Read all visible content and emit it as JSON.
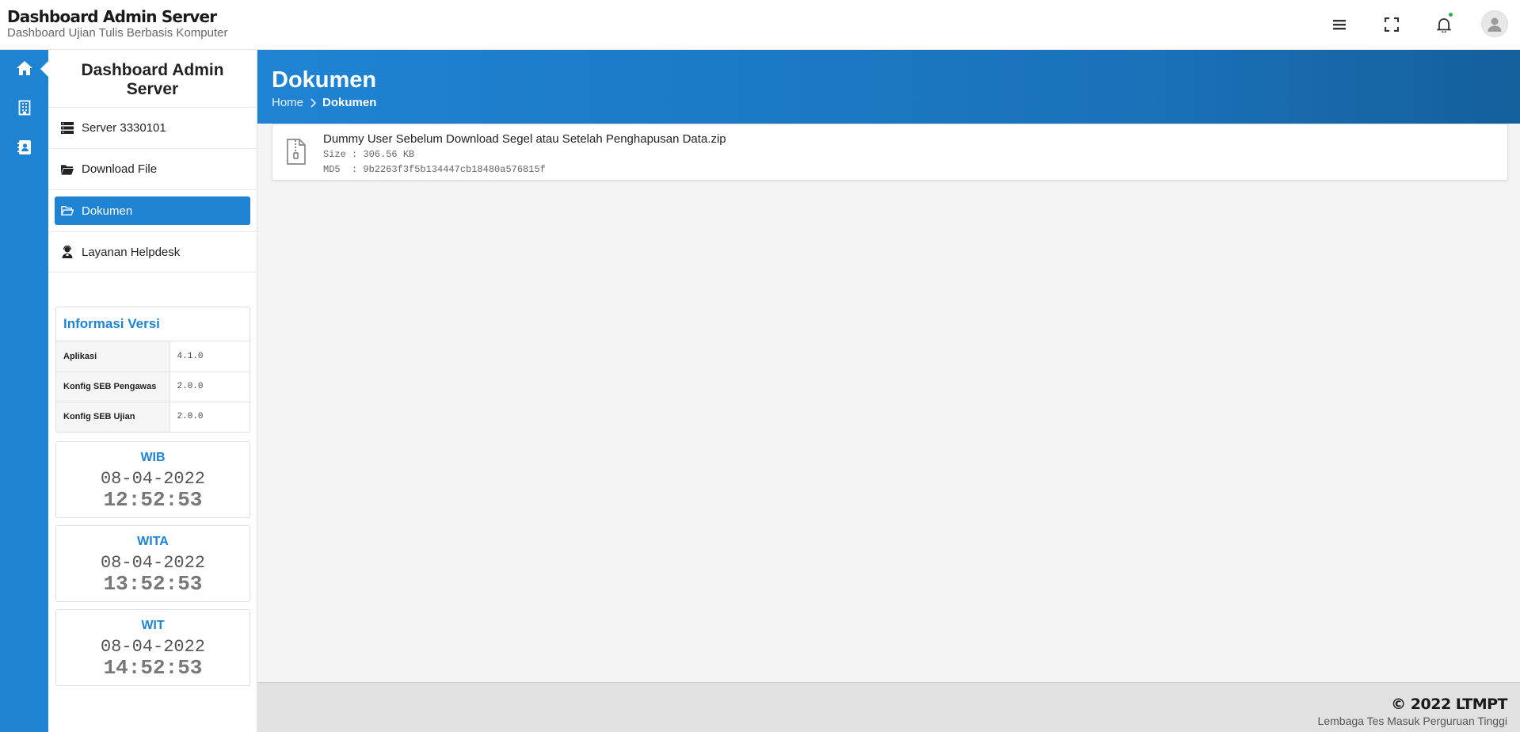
{
  "header": {
    "title": "Dashboard Admin Server",
    "subtitle": "Dashboard Ujian Tulis Berbasis Komputer"
  },
  "rail": {
    "items": [
      {
        "icon": "home-icon"
      },
      {
        "icon": "building-icon"
      },
      {
        "icon": "contact-book-icon"
      }
    ]
  },
  "sidebar": {
    "title": "Dashboard Admin Server",
    "items": [
      {
        "label": "Server 3330101",
        "icon": "server-icon"
      },
      {
        "label": "Download File",
        "icon": "folder-icon"
      },
      {
        "label": "Dokumen",
        "icon": "folder-open-icon",
        "active": true
      },
      {
        "label": "Layanan Helpdesk",
        "icon": "user-headset-icon"
      }
    ]
  },
  "version_info": {
    "title": "Informasi Versi",
    "rows": [
      {
        "key": "Aplikasi",
        "value": "4.1.0"
      },
      {
        "key": "Konfig SEB Pengawas",
        "value": "2.0.0"
      },
      {
        "key": "Konfig SEB Ujian",
        "value": "2.0.0"
      }
    ]
  },
  "clocks": [
    {
      "zone": "WIB",
      "date": "08-04-2022",
      "time": "12:52:53"
    },
    {
      "zone": "WITA",
      "date": "08-04-2022",
      "time": "13:52:53"
    },
    {
      "zone": "WIT",
      "date": "08-04-2022",
      "time": "14:52:53"
    }
  ],
  "main": {
    "title": "Dokumen",
    "breadcrumb": {
      "home": "Home",
      "current": "Dokumen"
    },
    "file": {
      "name": "Dummy User Sebelum Download Segel atau Setelah Penghapusan Data.zip",
      "size": "Size : 306.56 KB",
      "md5": "MD5  : 9b2263f3f5b134447cb18480a576815f"
    }
  },
  "footer": {
    "copyright": "© 2022 LTMPT",
    "org": "Lembaga Tes Masuk Perguruan Tinggi"
  },
  "colors": {
    "accent": "#1f83d4",
    "notification_dot": "#27b04f"
  }
}
